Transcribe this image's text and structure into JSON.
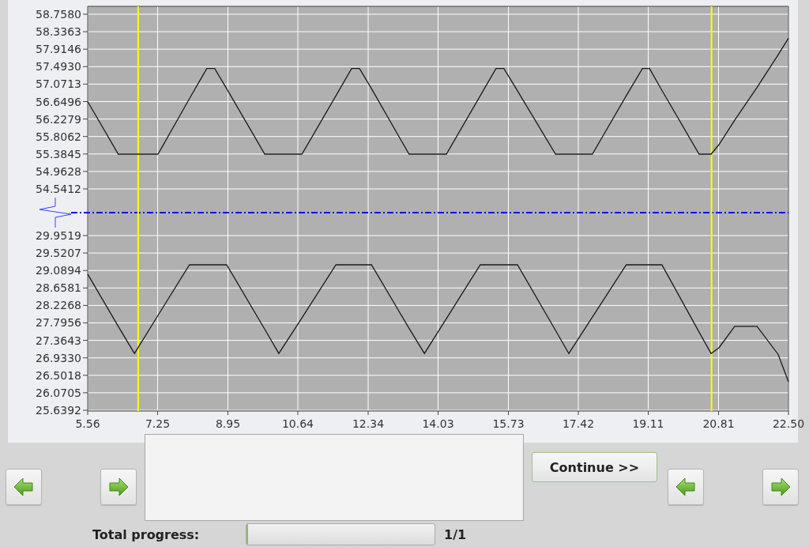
{
  "chart": {
    "upper_part": {
      "chart_data": {
        "type": "line",
        "x": [
          5.56,
          6.3,
          6.69,
          7.26,
          8.02,
          8.44,
          8.63,
          8.92,
          9.84,
          10.18,
          10.74,
          11.56,
          11.94,
          12.13,
          12.42,
          13.33,
          13.7,
          14.23,
          15.05,
          15.43,
          15.62,
          15.95,
          16.87,
          17.19,
          17.76,
          18.58,
          18.97,
          19.14,
          19.44,
          20.34,
          20.63,
          20.82,
          21.2,
          21.74,
          22.25,
          22.5
        ],
        "series": [
          {
            "color": "#1a1a1a",
            "values": [
              56.65,
              55.38,
              55.38,
              55.38,
              56.72,
              57.45,
              57.45,
              56.96,
              55.38,
              55.38,
              55.38,
              56.79,
              57.45,
              57.45,
              56.96,
              55.38,
              55.38,
              55.38,
              56.79,
              57.45,
              57.45,
              56.91,
              55.38,
              55.38,
              55.38,
              56.79,
              57.45,
              57.45,
              56.92,
              55.38,
              55.38,
              55.61,
              56.2,
              56.99,
              57.78,
              58.18
            ]
          }
        ],
        "xlim": [
          5.56,
          22.5
        ],
        "ylim": [
          54.5412,
          58.758
        ],
        "yticks": [
          {
            "value": 58.758,
            "label": "58.7580"
          },
          {
            "value": 58.3363,
            "label": "58.3363"
          },
          {
            "value": 57.9146,
            "label": "57.9146"
          },
          {
            "value": 57.493,
            "label": "57.4930"
          },
          {
            "value": 57.0713,
            "label": "57.0713"
          },
          {
            "value": 56.6496,
            "label": "56.6496"
          },
          {
            "value": 56.2279,
            "label": "56.2279"
          },
          {
            "value": 55.8062,
            "label": "55.8062"
          },
          {
            "value": 55.3845,
            "label": "55.3845"
          },
          {
            "value": 54.9628,
            "label": "54.9628"
          },
          {
            "value": 54.5412,
            "label": "54.5412"
          }
        ],
        "grid": true,
        "ref_lines": [
          {
            "axis": "x",
            "value": 6.78,
            "color": "#ffff00"
          },
          {
            "axis": "x",
            "value": 20.64,
            "color": "#ffff00"
          }
        ]
      }
    },
    "lower_part": {
      "chart_data": {
        "type": "line",
        "x": [
          5.56,
          6.3,
          6.69,
          7.26,
          8.02,
          8.44,
          8.63,
          8.92,
          9.84,
          10.18,
          10.74,
          11.56,
          11.94,
          12.13,
          12.42,
          13.33,
          13.7,
          14.23,
          15.05,
          15.43,
          15.62,
          15.95,
          16.87,
          17.19,
          17.76,
          18.58,
          18.97,
          19.14,
          19.44,
          20.34,
          20.63,
          20.82,
          21.2,
          21.74,
          22.25,
          22.5
        ],
        "series": [
          {
            "color": "#1a1a1a",
            "values": [
              29.0,
              27.71,
              27.04,
              27.98,
              29.23,
              29.23,
              29.23,
              29.23,
              27.64,
              27.04,
              27.92,
              29.23,
              29.23,
              29.23,
              29.23,
              27.66,
              27.04,
              27.9,
              29.23,
              29.23,
              29.23,
              29.23,
              27.61,
              27.04,
              27.94,
              29.23,
              29.23,
              29.23,
              29.23,
              27.57,
              27.04,
              27.18,
              27.71,
              27.71,
              27.02,
              26.34
            ]
          }
        ],
        "xlim": [
          5.56,
          22.5
        ],
        "ylim": [
          25.6392,
          29.9519
        ],
        "xticks": [
          {
            "value": 5.56,
            "label": "5.56"
          },
          {
            "value": 7.25,
            "label": "7.25"
          },
          {
            "value": 8.95,
            "label": "8.95"
          },
          {
            "value": 10.64,
            "label": "10.64"
          },
          {
            "value": 12.34,
            "label": "12.34"
          },
          {
            "value": 14.03,
            "label": "14.03"
          },
          {
            "value": 15.73,
            "label": "15.73"
          },
          {
            "value": 17.42,
            "label": "17.42"
          },
          {
            "value": 19.11,
            "label": "19.11"
          },
          {
            "value": 20.81,
            "label": "20.81"
          },
          {
            "value": 22.5,
            "label": "22.50"
          }
        ],
        "yticks": [
          {
            "value": 29.9519,
            "label": "29.9519"
          },
          {
            "value": 29.5207,
            "label": "29.5207"
          },
          {
            "value": 29.0894,
            "label": "29.0894"
          },
          {
            "value": 28.6581,
            "label": "28.6581"
          },
          {
            "value": 28.2268,
            "label": "28.2268"
          },
          {
            "value": 27.7956,
            "label": "27.7956"
          },
          {
            "value": 27.3643,
            "label": "27.3643"
          },
          {
            "value": 26.933,
            "label": "26.9330"
          },
          {
            "value": 26.5018,
            "label": "26.5018"
          },
          {
            "value": 26.0705,
            "label": "26.0705"
          },
          {
            "value": 25.6392,
            "label": "25.6392"
          }
        ],
        "grid": true,
        "ref_lines": [
          {
            "axis": "x",
            "value": 6.78,
            "color": "#ffff00"
          },
          {
            "axis": "x",
            "value": 20.64,
            "color": "#ffff00"
          }
        ]
      }
    }
  },
  "continue_button": {
    "label": "Continue >>"
  },
  "progress": {
    "label": "Total progress:",
    "level": 0.01,
    "reading": "1/1"
  }
}
